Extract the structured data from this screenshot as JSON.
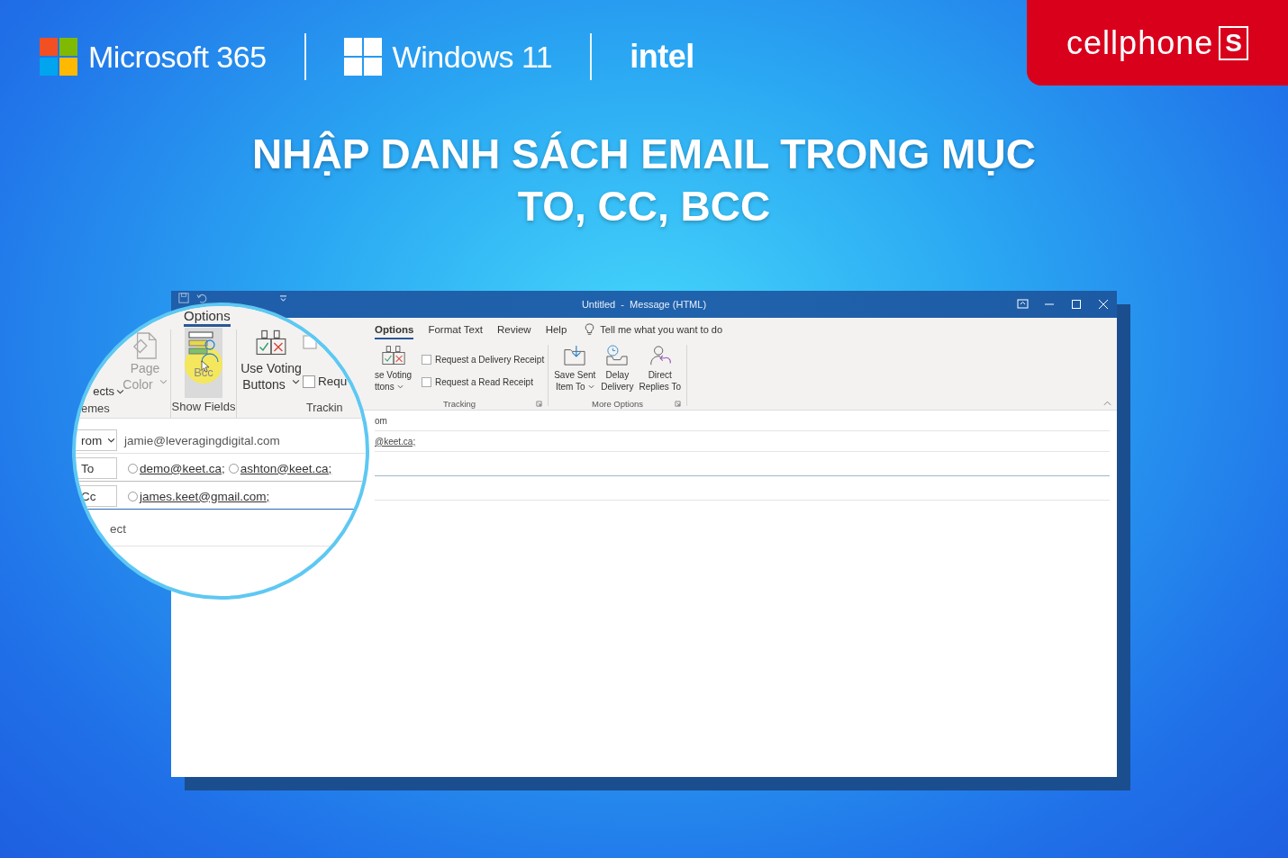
{
  "brand_bar": {
    "items": [
      {
        "kind": "microsoft",
        "label": "Microsoft 365"
      },
      {
        "kind": "windows",
        "label": "Windows 11"
      },
      {
        "kind": "plain",
        "label": "intel"
      }
    ]
  },
  "store_badge": {
    "name": "cellphone",
    "letter": "S"
  },
  "headline": "NHẬP DANH SÁCH EMAIL TRONG MỤC TO, CC, BCC",
  "window": {
    "title": "Untitled  -  Message (HTML)",
    "tabs": [
      {
        "label": "Options",
        "selected": true
      },
      {
        "label": "Format Text",
        "selected": false
      },
      {
        "label": "Review",
        "selected": false
      },
      {
        "label": "Help",
        "selected": false
      }
    ],
    "tell_me": "Tell me what you want to do",
    "voting": [
      "se Voting",
      "ttons"
    ],
    "receipts": [
      {
        "label": "Request a Delivery Receipt",
        "checked": false
      },
      {
        "label": "Request a Read Receipt",
        "checked": false
      }
    ],
    "tracking_label": "Tracking",
    "more_options": [
      {
        "kind": "save",
        "lines": [
          "Save Sent",
          "Item To"
        ],
        "dropdown": true
      },
      {
        "kind": "delay",
        "lines": [
          "Delay",
          "Delivery"
        ],
        "dropdown": false
      },
      {
        "kind": "replies",
        "lines": [
          "Direct",
          "Replies To"
        ],
        "dropdown": false
      }
    ],
    "more_options_label": "More Options",
    "from_fragment": "om",
    "to_fragment": "@keet.ca;"
  },
  "magnifier": {
    "tab": {
      "label": "Options",
      "selected": true
    },
    "page_color": [
      "Page",
      "Color"
    ],
    "effects_fragment": "ects",
    "themes_fragment": "emes",
    "bcc": {
      "label": "Bcc",
      "pressed": true
    },
    "show_fields_label": "Show Fields",
    "voting": [
      "Use Voting",
      "Buttons"
    ],
    "request": {
      "label": "Requ",
      "checked": false
    },
    "tracking_fragment": "Trackin",
    "from": {
      "label": "rom",
      "value": "jamie@leveragingdigital.com"
    },
    "to": {
      "label": "To",
      "recipients": [
        "demo@keet.ca;",
        "ashton@keet.ca;"
      ]
    },
    "cc": {
      "label": "Cc",
      "recipients": [
        "james.keet@gmail.com;"
      ]
    },
    "subject_fragment": "ect"
  }
}
